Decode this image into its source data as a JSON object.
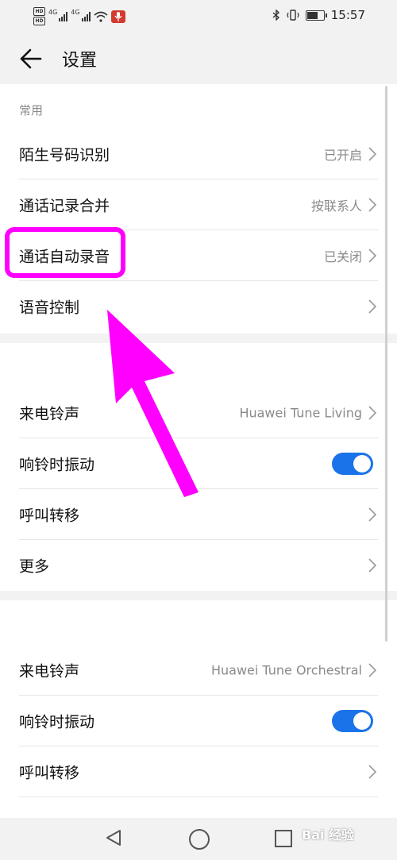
{
  "status_bar": {
    "time": "15:57",
    "net_label_1": "4G",
    "net_label_2": "4G",
    "hd_label": "HD"
  },
  "header": {
    "title": "设置"
  },
  "section_common": {
    "label": "常用",
    "rows": [
      {
        "label": "陌生号码识别",
        "value": "已开启"
      },
      {
        "label": "通话记录合并",
        "value": "按联系人"
      },
      {
        "label": "通话自动录音",
        "value": "已关闭"
      },
      {
        "label": "语音控制",
        "value": ""
      }
    ]
  },
  "section_sim1": {
    "rows": [
      {
        "label": "来电铃声",
        "value": "Huawei Tune Living"
      },
      {
        "label": "响铃时振动",
        "toggle_on": true
      },
      {
        "label": "呼叫转移",
        "value": ""
      },
      {
        "label": "更多",
        "value": ""
      }
    ]
  },
  "section_sim2": {
    "rows": [
      {
        "label": "来电铃声",
        "value": "Huawei Tune Orchestral"
      },
      {
        "label": "响铃时振动",
        "toggle_on": true
      },
      {
        "label": "呼叫转移",
        "value": ""
      }
    ]
  },
  "watermark": {
    "text": "Bai 经验"
  },
  "colors": {
    "accent": "#1a73e8",
    "annotation": "#ff00ff"
  }
}
